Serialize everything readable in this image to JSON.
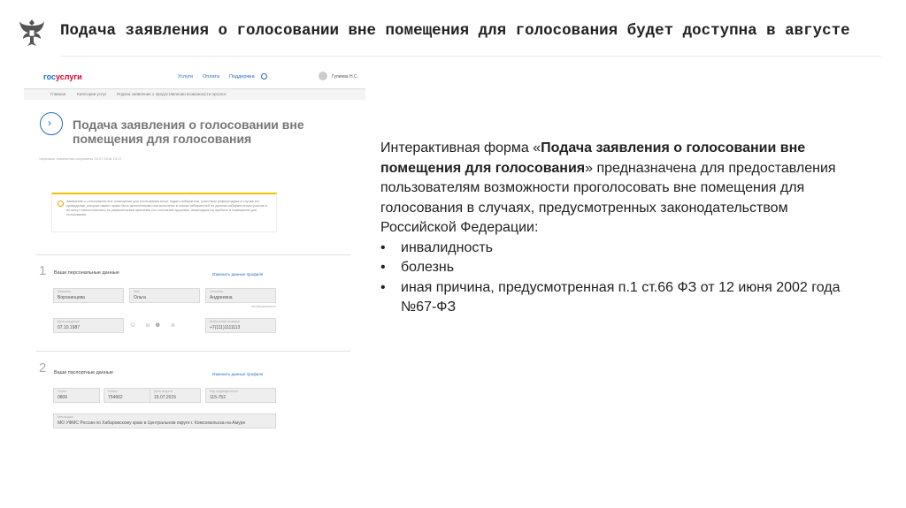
{
  "slide": {
    "title": "Подача заявления о голосовании вне помещения для голосования будет доступна в августе"
  },
  "screenshot": {
    "logo_part1": "гос",
    "logo_part2": "услуги",
    "nav": [
      "Услуги",
      "Оплата",
      "Поддержка"
    ],
    "user_name": "Гулиева Н.С.",
    "breadcrumbs": [
      "Главная",
      "Категории услуг",
      "Подача заявления о предоставлении возможности прголос"
    ],
    "form_title": "Подача заявления о голосовании вне помещения для голосования",
    "updated": "Черновик: изменения сохранены 20.07.2018 13:17",
    "warning": "Заявление о голосовании вне помещения для голосования могут подать избиратели, участники референдума в случае его проведения, которые имеют право быть включенными или включены в списки избирателей на данном избирательном участке и не могут самостоятельно по уважительным причинам (по состоянию здоровья, инвалидности) прибыть в помещение для голосования.",
    "step1_number": "1",
    "step1_title": "Ваши персональные данные",
    "step1_edit": "Изменить данные профиля",
    "lastname_label": "Фамилия",
    "lastname_value": "Воронинцева",
    "firstname_label": "Имя",
    "firstname_value": "Ольга",
    "middlename_label": "Отчество",
    "middlename_value": "Андреевна",
    "middlename_note": "необязательно",
    "birthdate_label": "Дата рождения",
    "birthdate_value": "07.10.1987",
    "gender_m": "М",
    "gender_f": "Ж",
    "phone_label": "Мобильный телефон",
    "phone_value": "+7(111)1111113",
    "step2_number": "2",
    "step2_title": "Ваши паспортные данные",
    "step2_edit": "Изменить данные профиля",
    "series_label": "Серия",
    "series_value": "0806",
    "number_label": "Номер",
    "number_value": "754662",
    "issued_date_label": "Дата выдачи",
    "issued_date_value": "15.07.2015",
    "code_label": "Код подразделения",
    "code_value": "115-752",
    "issued_by_label": "Кем выдан",
    "issued_by_value": "МО УФМС России по Хабаровскому краю в Центральном округе г. Комсомольска-на-Амуре"
  },
  "description": {
    "intro_prefix": "Интерактивная форма «",
    "intro_bold": "Подача заявления о голосовании вне помещения для голосования",
    "intro_suffix": "» предназначена для предоставления пользователям возможности проголосовать вне помещения для голосования в случаях, предусмотренных законодательством Российской Федерации:",
    "bullet_char": "•",
    "bullets": [
      "инвалидность",
      "болезнь",
      "иная причина, предусмотренная п.1 ст.66 ФЗ от 12 июня 2002 года №67-ФЗ"
    ]
  },
  "colors": {
    "gosuslugi_blue": "#1c6fc4",
    "gosuslugi_red": "#e4002b",
    "warning_yellow": "#f2c200"
  }
}
